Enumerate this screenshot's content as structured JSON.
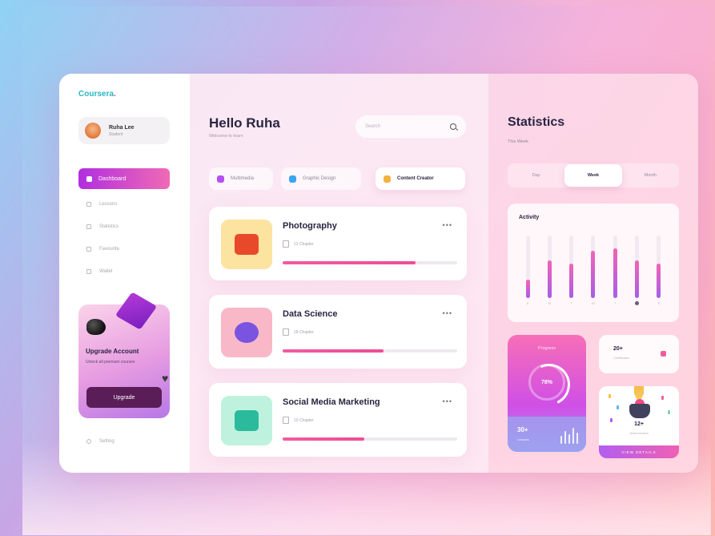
{
  "brand": {
    "logo_text": "Coursera",
    "logo_dot": "."
  },
  "profile": {
    "name": "Ruha Lee",
    "role": "Student"
  },
  "sidebar": {
    "active": {
      "label": "Dashboard"
    },
    "items": [
      {
        "label": "Lessons"
      },
      {
        "label": "Statistics"
      },
      {
        "label": "Favourite"
      },
      {
        "label": "Wallet"
      }
    ],
    "upgrade": {
      "title": "Upgrade Account",
      "desc": "Unlock all premium courses",
      "button": "Upgrade"
    },
    "setting": {
      "label": "Setting"
    }
  },
  "main": {
    "greeting": "Hello Ruha",
    "greeting_sub": "Welcome to learn",
    "search": {
      "placeholder": "Search"
    },
    "chips": [
      {
        "label": "Multimedia",
        "color": "#b64ff0"
      },
      {
        "label": "Graphic Design",
        "color": "#3ca4ef"
      },
      {
        "label": "Content Creator",
        "color": "#f3b23c"
      }
    ],
    "courses": [
      {
        "title": "Photography",
        "meta": "12 Chapter",
        "progress": 0.76,
        "thumb_bg": "#fde3a0",
        "obj_color": "#e8492b"
      },
      {
        "title": "Data Science",
        "meta": "18 Chapter",
        "progress": 0.58,
        "thumb_bg": "#f8b8c8",
        "obj_color": "#7a54e0"
      },
      {
        "title": "Social Media Marketing",
        "meta": "10 Chapter",
        "progress": 0.47,
        "thumb_bg": "#bff2de",
        "obj_color": "#2bbb9c"
      }
    ],
    "more_label": "•••"
  },
  "stats": {
    "title": "Statistics",
    "subtitle": "This Week",
    "tabs": [
      {
        "label": "Day",
        "active": false
      },
      {
        "label": "Week",
        "active": true
      },
      {
        "label": "Month",
        "active": false
      }
    ],
    "activity": {
      "title": "Activity",
      "bars": [
        {
          "label": "S",
          "value": 0.3,
          "active": false
        },
        {
          "label": "M",
          "value": 0.6,
          "active": false
        },
        {
          "label": "T",
          "value": 0.55,
          "active": false
        },
        {
          "label": "W",
          "value": 0.75,
          "active": false
        },
        {
          "label": "T",
          "value": 0.8,
          "active": false
        },
        {
          "label": "F",
          "value": 0.6,
          "active": true
        },
        {
          "label": "S",
          "value": 0.55,
          "active": false
        }
      ]
    },
    "progress_card": {
      "label": "Progress",
      "ring_value": "78%",
      "num": "30+",
      "small": "Lessons",
      "mini_bars": [
        10,
        16,
        12,
        20,
        14
      ]
    },
    "small_card": {
      "num": "20+",
      "sub": "Certificates"
    },
    "badge_card": {
      "num": "12+",
      "sub": "Achievement",
      "bar_text": "VIEW DETAILS"
    }
  }
}
